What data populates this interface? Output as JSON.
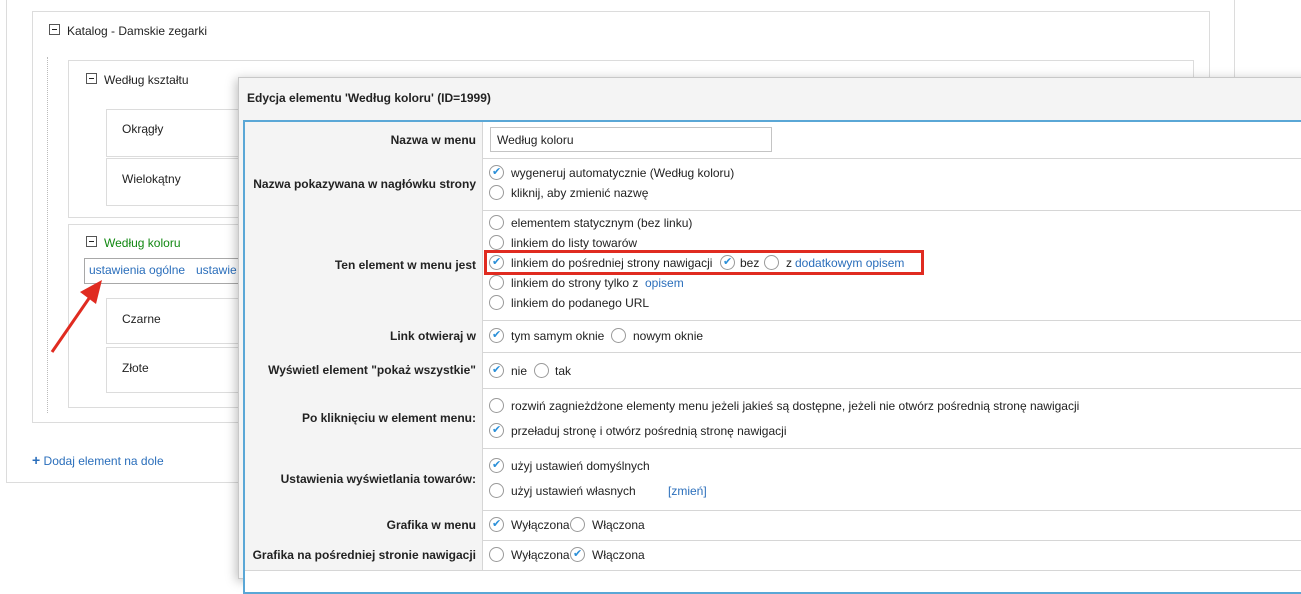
{
  "tree": {
    "root": {
      "label": "Katalog - Damskie zegarki"
    },
    "group_shape": {
      "label": "Według kształtu",
      "items": [
        "Okrągły",
        "Wielokątny"
      ]
    },
    "group_color": {
      "label": "Według koloru",
      "tabs": [
        "ustawienia ogólne",
        "ustawie"
      ],
      "items": [
        "Czarne",
        "Złote"
      ]
    },
    "add_bottom": "Dodaj element na dole"
  },
  "dialog": {
    "title": "Edycja elementu 'Według koloru' (ID=1999)",
    "rows": {
      "menu_name": {
        "label": "Nazwa w menu",
        "value": "Według koloru"
      },
      "header_name": {
        "label": "Nazwa pokazywana w nagłówku strony",
        "options": [
          "wygeneruj automatycznie (Według koloru)",
          "kliknij, aby zmienić nazwę"
        ]
      },
      "element_type": {
        "label": "Ten element w menu jest",
        "opt_static": "elementem statycznym (bez linku)",
        "opt_list": "linkiem do listy towarów",
        "opt_nav": "linkiem do pośredniej strony nawigacji",
        "opt_nav_without": "bez",
        "opt_nav_with_prefix": "z",
        "opt_nav_with_link": "dodatkowym opisem",
        "opt_page_prefix": "linkiem do strony tylko z",
        "opt_page_link": "opisem",
        "opt_url": "linkiem do podanego URL"
      },
      "link_open": {
        "label": "Link otwieraj w",
        "options": [
          "tym samym oknie",
          "nowym oknie"
        ]
      },
      "show_all": {
        "label": "Wyświetl element \"pokaż wszystkie\"",
        "options": [
          "nie",
          "tak"
        ]
      },
      "on_click": {
        "label": "Po kliknięciu w element menu:",
        "options": [
          "rozwiń zagnieżdżone elementy menu jeżeli jakieś są dostępne, jeżeli nie otwórz pośrednią stronę nawigacji",
          "przeładuj stronę i otwórz pośrednią stronę nawigacji"
        ]
      },
      "product_display": {
        "label": "Ustawienia wyświetlania towarów:",
        "opt_default": "użyj ustawień domyślnych",
        "opt_own": "użyj ustawień własnych",
        "change_link": "[zmień]"
      },
      "menu_graphic": {
        "label": "Grafika w menu",
        "options": [
          "Wyłączona",
          "Włączona"
        ]
      },
      "nav_graphic": {
        "label": "Grafika na pośredniej stronie nawigacji",
        "options": [
          "Wyłączona",
          "Włączona"
        ]
      }
    }
  },
  "colors": {
    "highlight": "#e02b20",
    "link": "#2a6ebb",
    "active_tree": "#118811",
    "frame": "#5aa7d6"
  }
}
